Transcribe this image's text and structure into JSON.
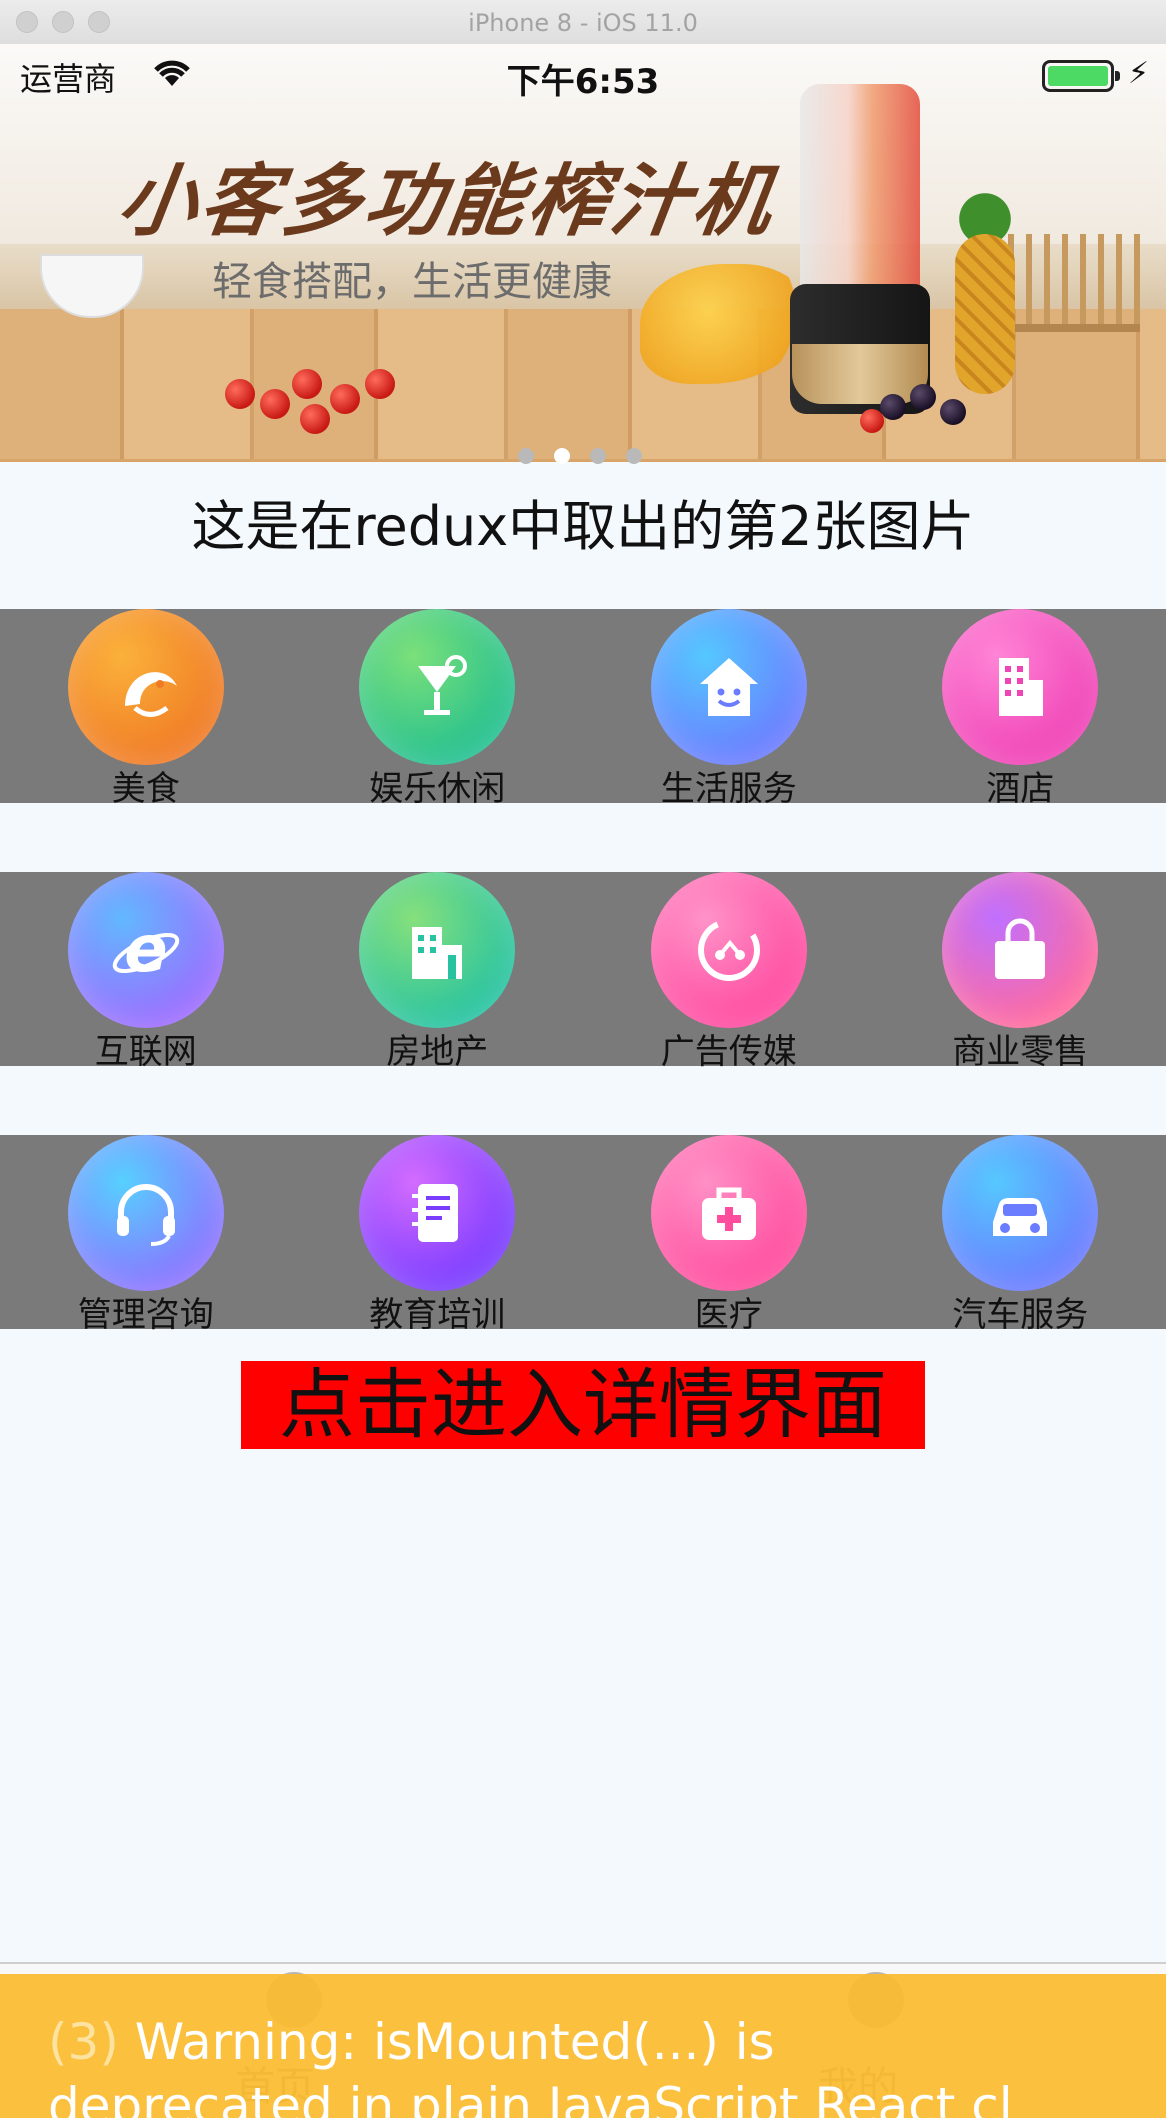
{
  "window": {
    "title": "iPhone 8 - iOS 11.0"
  },
  "status_bar": {
    "carrier": "运营商",
    "time": "下午6:53",
    "charging_symbol": "⚡"
  },
  "banner": {
    "headline": "小客多功能榨汁机",
    "subline": "轻食搭配，生活更健康",
    "pager": {
      "count": 4,
      "active_index": 1
    }
  },
  "caption": "这是在redux中取出的第2张图片",
  "categories": [
    {
      "label": "美食",
      "icon": "shrimp-icon",
      "color": [
        "#fbb13b",
        "#f07b25"
      ]
    },
    {
      "label": "娱乐休闲",
      "icon": "cocktail-icon",
      "color": [
        "#7be07a",
        "#24c08f"
      ]
    },
    {
      "label": "生活服务",
      "icon": "house-smile-icon",
      "color": [
        "#55c8ff",
        "#6a7cff"
      ]
    },
    {
      "label": "酒店",
      "icon": "building-icon",
      "color": [
        "#ff84d6",
        "#f043b6"
      ]
    },
    {
      "label": "互联网",
      "icon": "internet-e-icon",
      "color": [
        "#62b8ff",
        "#9b6dff"
      ]
    },
    {
      "label": "房地产",
      "icon": "real-estate-icon",
      "color": [
        "#86e07c",
        "#27c3a0"
      ]
    },
    {
      "label": "广告传媒",
      "icon": "media-icon",
      "color": [
        "#ff93c8",
        "#ff4aa0"
      ]
    },
    {
      "label": "商业零售",
      "icon": "shopping-bag-icon",
      "color": [
        "#c070ff",
        "#ff6a9e"
      ]
    },
    {
      "label": "管理咨询",
      "icon": "headset-icon",
      "color": [
        "#57d0ff",
        "#8a74ff"
      ]
    },
    {
      "label": "教育培训",
      "icon": "notebook-icon",
      "color": [
        "#d36cff",
        "#7a3cff"
      ]
    },
    {
      "label": "医疗",
      "icon": "medical-kit-icon",
      "color": [
        "#ff90c6",
        "#ff4d9e"
      ]
    },
    {
      "label": "汽车服务",
      "icon": "car-icon",
      "color": [
        "#56c8ff",
        "#6a7cff"
      ]
    }
  ],
  "detail_button": {
    "label": "点击进入详情界面"
  },
  "tab_bar": {
    "tabs": [
      {
        "label": "首页"
      },
      {
        "label": "我的"
      }
    ]
  },
  "warning": {
    "count": "(3)",
    "message": "Warning: isMounted(...) is",
    "message_line2": "deprecated in plain JavaScript React cl"
  },
  "colors": {
    "category_row_bg": "#7a7a7a",
    "page_bg": "#f4f9fe",
    "button_bg": "#ff0000",
    "warning_bg": "#fbbb2f"
  }
}
